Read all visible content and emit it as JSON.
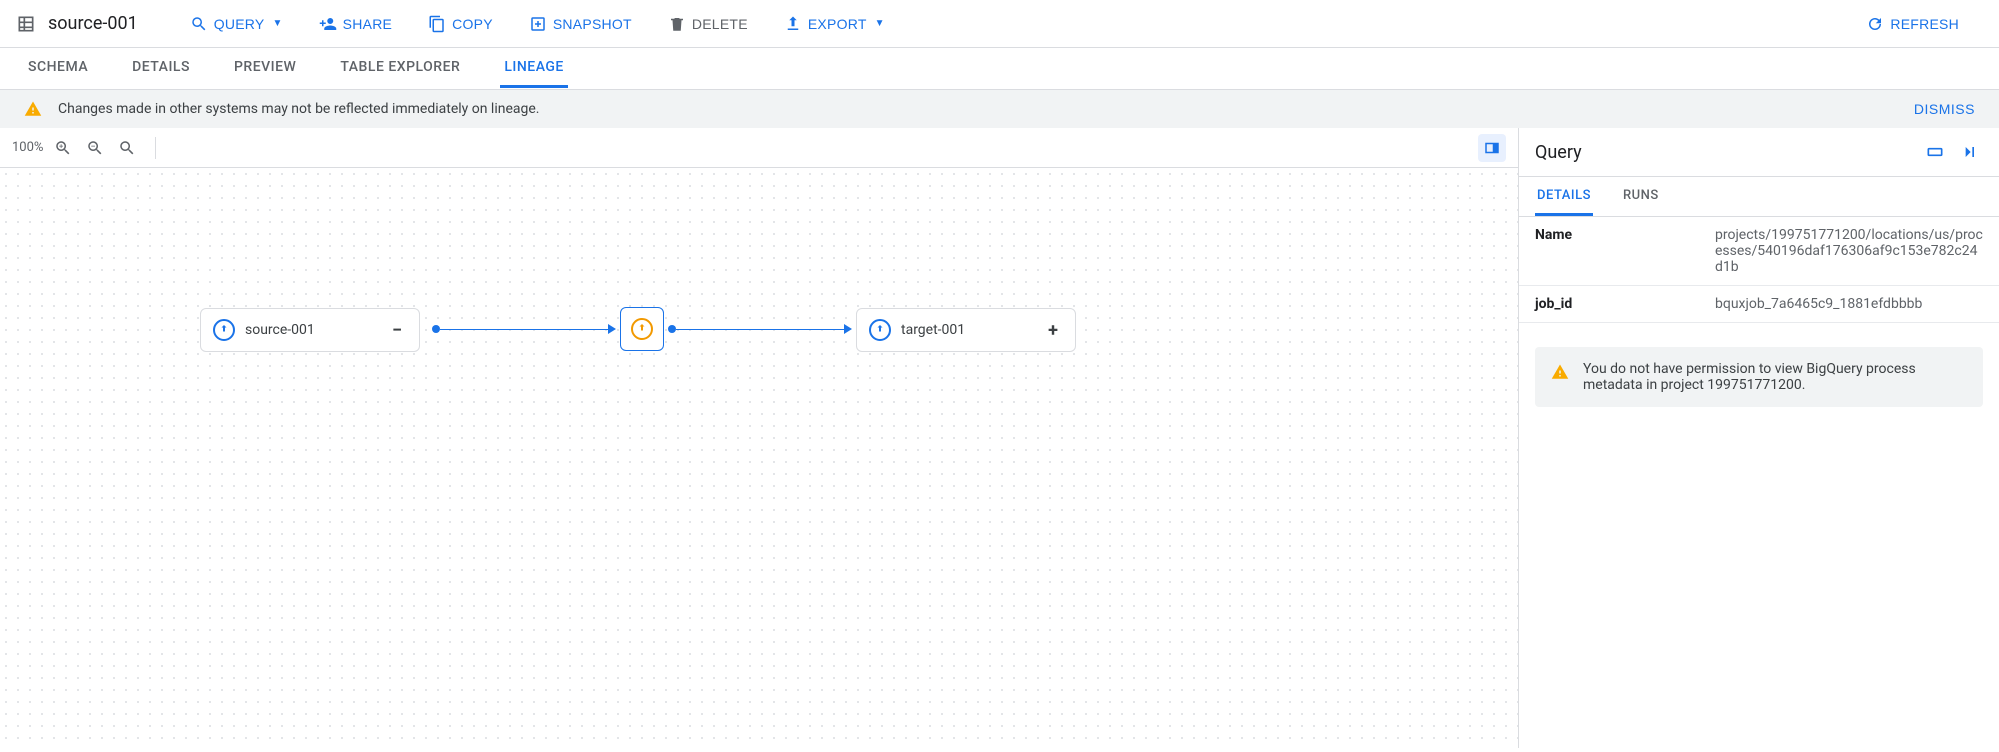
{
  "header": {
    "title": "source-001",
    "buttons": {
      "query": "QUERY",
      "share": "SHARE",
      "copy": "COPY",
      "snapshot": "SNAPSHOT",
      "delete": "DELETE",
      "export": "EXPORT",
      "refresh": "REFRESH"
    }
  },
  "tabs": {
    "schema": "SCHEMA",
    "details": "DETAILS",
    "preview": "PREVIEW",
    "table_explorer": "TABLE EXPLORER",
    "lineage": "LINEAGE"
  },
  "banner": {
    "message": "Changes made in other systems may not be reflected immediately on lineage.",
    "dismiss": "DISMISS"
  },
  "canvas": {
    "zoom": "100%",
    "nodes": {
      "source": "source-001",
      "target": "target-001",
      "source_collapse": "−",
      "target_expand": "+"
    }
  },
  "side": {
    "title": "Query",
    "tabs": {
      "details": "DETAILS",
      "runs": "RUNS"
    },
    "rows": {
      "name_label": "Name",
      "name_value": "projects/199751771200/locations/us/processes/540196daf176306af9c153e782c24d1b",
      "jobid_label": "job_id",
      "jobid_value": "bquxjob_7a6465c9_1881efdbbbb"
    },
    "permission_warning": "You do not have permission to view BigQuery process metadata in project 199751771200."
  }
}
